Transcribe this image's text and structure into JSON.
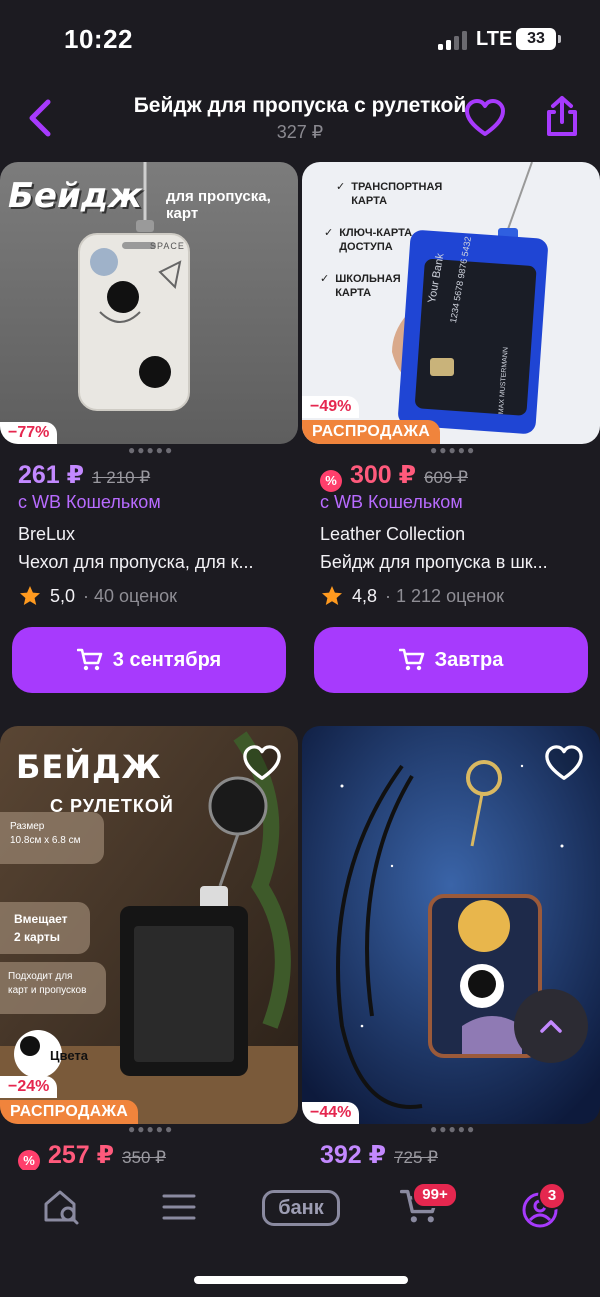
{
  "status": {
    "time": "10:22",
    "network": "LTE",
    "battery": "33"
  },
  "header": {
    "title": "Бейдж для пропуска с рулеткой",
    "price": "327 ₽"
  },
  "products": [
    {
      "discount": "−77%",
      "sale": "",
      "price": "261 ₽",
      "old_price": "1 210 ₽",
      "wallet": "с WB Кошельком",
      "brand": "BreLux",
      "name": "Чехол для пропуска, для к...",
      "rating": "5,0",
      "reviews": "· 40 оценок",
      "button": "3 сентября",
      "image_text": {
        "title": "Бейдж",
        "subtitle": "для пропуска, карт",
        "card": "SPACE"
      }
    },
    {
      "discount": "−49%",
      "sale": "РАСПРОДАЖА",
      "price": "300 ₽",
      "old_price": "609 ₽",
      "wallet": "с WB Кошельком",
      "brand": "Leather Collection",
      "name": "Бейдж для пропуска в шк...",
      "rating": "4,8",
      "reviews": "· 1 212 оценок",
      "button": "Завтра",
      "image_text": {
        "opt1a": "ТРАНСПОРТНАЯ",
        "opt1b": "КАРТА",
        "opt2a": "КЛЮЧ-КАРТА",
        "opt2b": "ДОСТУПА",
        "opt3a": "ШКОЛЬНАЯ",
        "opt3b": "КАРТА",
        "bank": "Your Bank",
        "number": "1234 5678 9876 5432",
        "holder": "MAX MUSTERMANN"
      }
    },
    {
      "discount": "−24%",
      "sale": "РАСПРОДАЖА",
      "price": "257 ₽",
      "old_price": "350 ₽",
      "image_text": {
        "title": "БЕЙДЖ",
        "subtitle": "С РУЛЕТКОЙ",
        "size_label": "Размер",
        "size_value": "10.8см х 6.8 см",
        "fits_label": "Вмещает",
        "fits_value": "2 карты",
        "for_label": "Подходит для",
        "for_value": "карт и пропусков",
        "colors": "Цвета"
      }
    },
    {
      "discount": "−44%",
      "sale": "",
      "price": "392 ₽",
      "old_price": "725 ₽"
    }
  ],
  "nav": {
    "bank": "банк",
    "cart_badge": "99+",
    "profile_badge": "3"
  },
  "colors": {
    "accent": "#a73afd",
    "price": "#c389ff",
    "discount": "#e5274f",
    "sale": "#f0843c",
    "background": "#1c1b21"
  }
}
